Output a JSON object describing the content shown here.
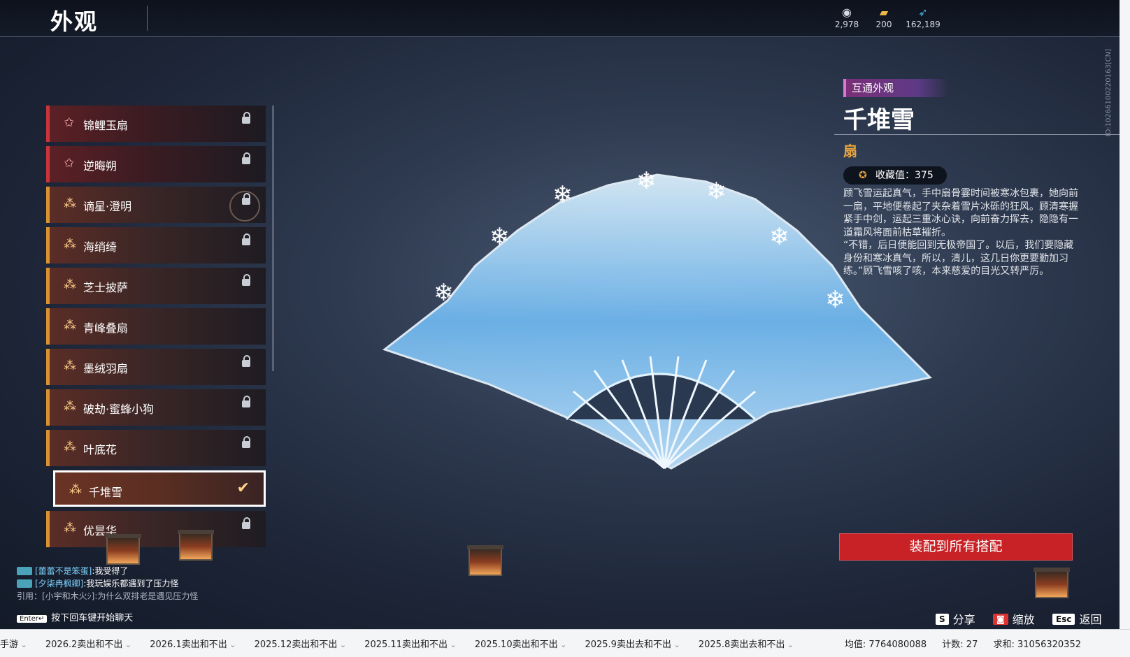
{
  "header": {
    "title": "外观",
    "currencies": [
      {
        "icon": "silver-coin-icon",
        "value": "2,978"
      },
      {
        "icon": "gold-ingot-icon",
        "value": "200"
      },
      {
        "icon": "feather-icon",
        "value": "162,189"
      }
    ]
  },
  "list": {
    "items": [
      {
        "label": "锦鲤玉扇",
        "rarity": "red",
        "status": "locked"
      },
      {
        "label": "逆晦朔",
        "rarity": "red",
        "status": "locked"
      },
      {
        "label": "谪星·澄明",
        "rarity": "gold",
        "status": "locked"
      },
      {
        "label": "海绡绮",
        "rarity": "gold",
        "status": "locked"
      },
      {
        "label": "芝士披萨",
        "rarity": "gold",
        "status": "locked"
      },
      {
        "label": "青峰叠扇",
        "rarity": "gold",
        "status": "none"
      },
      {
        "label": "墨绒羽扇",
        "rarity": "gold",
        "status": "locked"
      },
      {
        "label": "破劫·蜜蜂小狗",
        "rarity": "gold",
        "status": "locked"
      },
      {
        "label": "叶底花",
        "rarity": "gold",
        "status": "locked"
      },
      {
        "label": "千堆雪",
        "rarity": "gold",
        "status": "selected"
      },
      {
        "label": "优昙华",
        "rarity": "gold",
        "status": "locked"
      }
    ]
  },
  "detail": {
    "tag": "互通外观",
    "name": "千堆雪",
    "type": "扇",
    "collect_label": "收藏值：375",
    "description": "顾飞雪运起真气，手中扇骨霎时间被寒冰包裹，她向前一扇，平地便卷起了夹杂着雪片冰砾的狂风。顾清寒握紧手中剑，运起三重冰心诀，向前奋力挥去，隐隐有一道霜风将面前枯草摧折。\n“不错，后日便能回到无极帝国了。以后，我们要隐藏身份和寒冰真气，所以，清儿，这几日你更要勤加习练。”顾飞雪咳了咳，本来慈爱的目光又转严厉。",
    "equip_button": "装配到所有搭配",
    "side_id": "ID:1026610022016​3[CN]"
  },
  "hints": {
    "share_key": "S",
    "share": "分享",
    "zoom": "缩放",
    "back_key": "Esc",
    "back": "返回"
  },
  "chat": {
    "lines": [
      {
        "name": "[蕾蕾不是笨蛋]",
        "text": ":我受得了"
      },
      {
        "name": "[夕柒冉枫卿]",
        "text": ":我玩娱乐都遇到了压力怪"
      }
    ],
    "quote": "引用：[小宇和木火ｼ]:为什么双排老是遇见压力怪",
    "enter_key": "Enter↵",
    "enter_hint": "按下回车键开始聊天"
  },
  "spreadsheet": {
    "tabs": [
      "手游",
      "2026.2卖出和不出",
      "2026.1卖出和不出",
      "2025.12卖出和不出",
      "2025.11卖出和不出",
      "2025.10卖出和不出",
      "2025.9卖出去和不出",
      "2025.8卖出去和不出"
    ],
    "average": "均值: 7764080088",
    "count": "计数: 27",
    "sum": "求和: 31056320352"
  },
  "colors": {
    "equip": "#c92226",
    "accent": "#e8a440",
    "tag": "#7b2f78"
  }
}
